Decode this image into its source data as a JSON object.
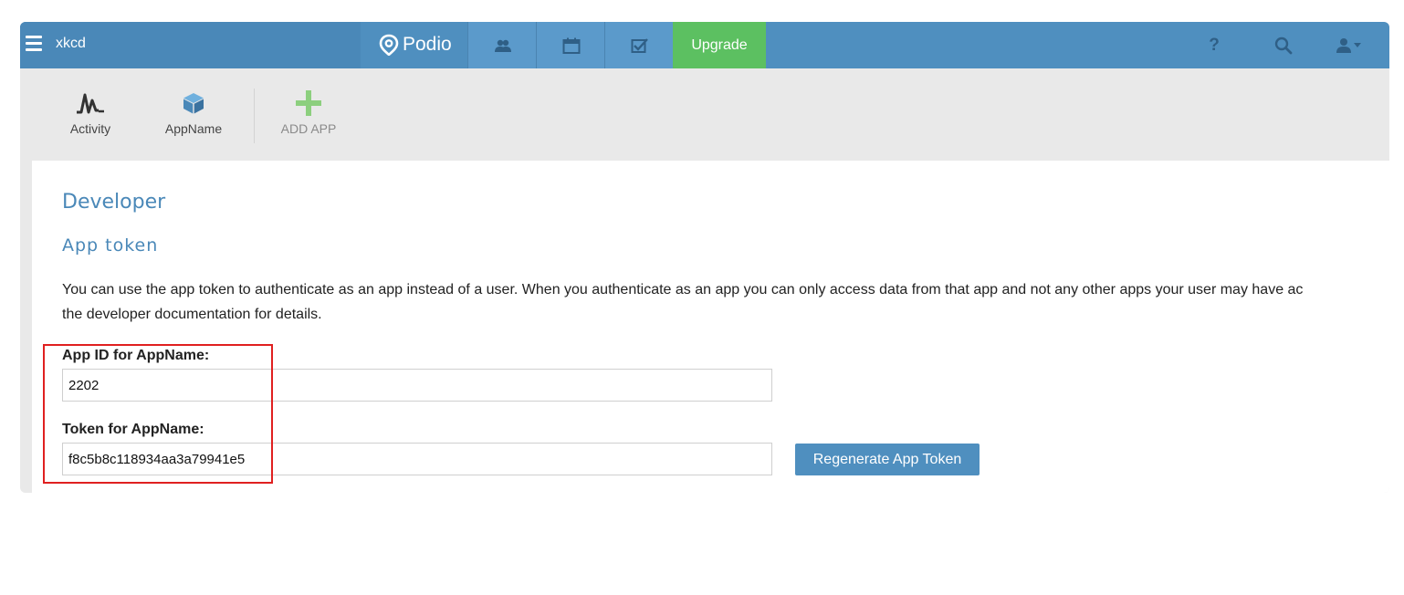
{
  "topbar": {
    "workspace": "xkcd",
    "brand": "Podio",
    "upgrade_label": "Upgrade",
    "help_label": "?",
    "colors": {
      "bar": "#4f8fbf",
      "upgrade": "#5cc061"
    }
  },
  "apps": {
    "items": [
      {
        "label": "Activity",
        "icon": "activity-icon"
      },
      {
        "label": "AppName",
        "icon": "cube-icon"
      }
    ],
    "add_label": "ADD APP"
  },
  "main": {
    "section_title": "Developer",
    "subsection_title": "App token",
    "description": "You can use the app token to authenticate as an app instead of a user. When you authenticate as an app you can only access data from that app and not any other apps your user may have ac\nthe developer documentation for details.",
    "app_id": {
      "label": "App ID for AppName:",
      "value": "2202"
    },
    "token": {
      "label": "Token for AppName:",
      "value": "f8c5b8c118934aa3a79941e5"
    },
    "regenerate_label": "Regenerate App Token"
  }
}
